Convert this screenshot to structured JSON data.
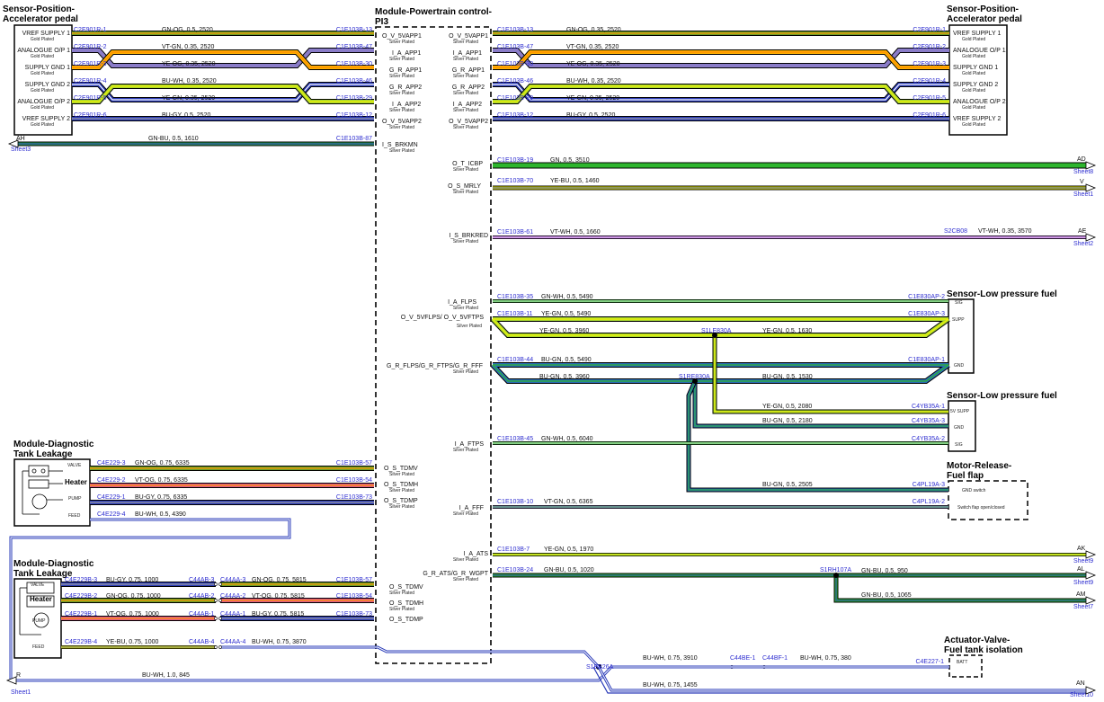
{
  "components": {
    "app_left": {
      "title1": "Sensor-Position-",
      "title2": "Accelerator pedal",
      "pins": [
        {
          "name": "VREF SUPPLY 1",
          "note": "Gold Plated"
        },
        {
          "name": "ANALOGUE O/P 1",
          "note": "Gold Plated"
        },
        {
          "name": "SUPPLY GND 1",
          "note": "Gold Plated"
        },
        {
          "name": "SUPPLY GND 2",
          "note": "Gold Plated"
        },
        {
          "name": "ANALOGUE O/P 2",
          "note": "Gold Plated"
        },
        {
          "name": "VREF SUPPLY 2",
          "note": "Gold Plated"
        }
      ]
    },
    "app_right": {
      "title1": "Sensor-Position-",
      "title2": "Accelerator pedal",
      "pins": [
        {
          "name": "VREF SUPPLY 1",
          "note": "Gold Plated"
        },
        {
          "name": "ANALOGUE O/P 1",
          "note": "Gold Plated"
        },
        {
          "name": "SUPPLY GND 1",
          "note": "Gold Plated"
        },
        {
          "name": "SUPPLY GND 2",
          "note": "Gold Plated"
        },
        {
          "name": "ANALOGUE O/P 2",
          "note": "Gold Plated"
        },
        {
          "name": "VREF SUPPLY 2",
          "note": "Gold Plated"
        }
      ]
    },
    "pcm": {
      "title1": "Module-Powertrain control-",
      "title2": "PI3"
    },
    "pcm_left_pins": [
      {
        "name": "O_V_5VAPP1",
        "note": "Silver Plated"
      },
      {
        "name": "I_A_APP1",
        "note": "Silver Plated"
      },
      {
        "name": "G_R_APP1",
        "note": "Silver Plated"
      },
      {
        "name": "G_R_APP2",
        "note": "Silver Plated"
      },
      {
        "name": "I_A_APP2",
        "note": "Silver Plated"
      },
      {
        "name": "O_V_5VAPP2",
        "note": "Silver Plated"
      },
      {
        "name": "I_S_BRKMN",
        "note": "Silver Plated"
      },
      {
        "name": "O_S_TDMV",
        "note": "Silver Plated"
      },
      {
        "name": "O_S_TDMH",
        "note": "Silver Plated"
      },
      {
        "name": "O_S_TDMP",
        "note": "Silver Plated"
      },
      {
        "name": "O_S_TDMV",
        "note": "Silver Plated"
      },
      {
        "name": "O_S_TDMH",
        "note": "Silver Plated"
      },
      {
        "name": "O_S_TDMP",
        "note": ""
      }
    ],
    "pcm_right_pins": [
      {
        "name": "O_V_5VAPP1",
        "note": "Silver Plated"
      },
      {
        "name": "I_A_APP1",
        "note": "Silver Plated"
      },
      {
        "name": "G_R_APP1",
        "note": "Silver Plated"
      },
      {
        "name": "G_R_APP2",
        "note": "Silver Plated"
      },
      {
        "name": "I_A_APP2",
        "note": "Silver Plated"
      },
      {
        "name": "O_V_5VAPP2",
        "note": "Silver Plated"
      },
      {
        "name": "O_T_ICBP",
        "note": "Silver Plated"
      },
      {
        "name": "O_S_MRLY",
        "note": "Silver Plated"
      },
      {
        "name": "I_S_BRKRED",
        "note": "Silver Plated"
      },
      {
        "name": "I_A_FLPS",
        "note": "Silver Plated"
      },
      {
        "name": "O_V_5VFLPS/ O_V_5VFTPS",
        "note": "Silver Plated"
      },
      {
        "name": "G_R_FLPS/G_R_FTPS/G_R_FFF",
        "note": "Silver Plated"
      },
      {
        "name": "I_A_FTPS",
        "note": "Silver Plated"
      },
      {
        "name": "I_A_FFF",
        "note": "Silver Plated"
      },
      {
        "name": "I_A_ATS",
        "note": "Silver Plated"
      },
      {
        "name": "G_R_ATS/G_R_WGPT",
        "note": "Silver Plated"
      }
    ],
    "lpf1": {
      "title": "Sensor-Low pressure fuel",
      "pins": [
        "SIG",
        "SUPP",
        "GND"
      ]
    },
    "lpf2": {
      "title": "Sensor-Low pressure fuel",
      "pins": [
        "5V SUPP",
        "GND",
        "SIG"
      ]
    },
    "motor": {
      "title1": "Motor-Release-",
      "title2": "Fuel flap",
      "line1": "GND switch",
      "line2": "Switch flap open/closed"
    },
    "dtl1": {
      "title1": "Module-Diagnostic",
      "title2": "Tank Leakage",
      "pins": [
        "VALVE",
        "Heater",
        "PUMP",
        "FEED"
      ]
    },
    "dtl2": {
      "title1": "Module-Diagnostic",
      "title2": "Tank Leakage",
      "pins": [
        "VALVE",
        "Heater",
        "PUMP",
        "FEED"
      ]
    },
    "valve": {
      "title1": "Actuator-Valve-",
      "title2": "Fuel tank isolation",
      "pin": "BATT"
    }
  },
  "wires_left_app": [
    {
      "from": "C2E901R-1",
      "spec": "GN-OG, 0.5, 2520",
      "to": "C1E103B-13"
    },
    {
      "from": "C2E901R-2",
      "spec": "VT-GN, 0.35, 2520",
      "to": "C1E103B-47"
    },
    {
      "from": "C2E901R-3",
      "spec": "YE-OG, 0.35, 2520",
      "to": "C1E103B-30"
    },
    {
      "from": "C2E901R-4",
      "spec": "BU-WH, 0.35, 2520",
      "to": "C1E103B-46"
    },
    {
      "from": "C2E901R-5",
      "spec": "YE-GN, 0.35, 2520",
      "to": "C1E103B-29"
    },
    {
      "from": "C2E901R-6",
      "spec": "BU-GY, 0.5, 2520",
      "to": "C1E103B-12"
    }
  ],
  "wire_brkmn": {
    "label": "AH",
    "sheet": "Sheet3",
    "spec": "GN-BU, 0.5, 1610",
    "to": "C1E103B-87"
  },
  "wires_right_app": [
    {
      "from": "C1E103B-13",
      "spec": "GN-OG, 0.35, 2520",
      "to": "C2E901R-1"
    },
    {
      "from": "C1E103B-47",
      "spec": "VT-GN, 0.35, 2520",
      "to": "C2E901R-2"
    },
    {
      "from": "C1E103B-30",
      "spec": "YE-OG, 0.35, 2520",
      "to": "C2E901R-3"
    },
    {
      "from": "C1E103B-46",
      "spec": "BU-WH, 0.35, 2520",
      "to": "C2E901R-4"
    },
    {
      "from": "C1E103B-29",
      "spec": "YE-GN, 0.35, 2520",
      "to": "C2E901R-5"
    },
    {
      "from": "C1E103B-12",
      "spec": "BU-GY, 0.5, 2520",
      "to": "C2E901R-6"
    }
  ],
  "wires_right_misc": {
    "icbp": {
      "from": "C1E103B-19",
      "spec": "GN, 0.5, 3510",
      "label": "AD",
      "sheet": "Sheet8"
    },
    "mrly": {
      "from": "C1E103B-70",
      "spec": "YE-BU, 0.5, 1460",
      "label": "V",
      "sheet": "Sheet1"
    },
    "brkred": {
      "from": "C1E103B-61",
      "spec": "VT-WH, 0.5, 1660",
      "splice": "S2CB08",
      "spec2": "VT-WH, 0.35, 3570",
      "label": "AE",
      "sheet": "Sheet2"
    }
  },
  "wires_fuel": {
    "flps_sig": {
      "from": "C1E103B-35",
      "spec": "GN-WH, 0.5, 5490",
      "to": "C1E830AP-2"
    },
    "supp": {
      "from": "C1E103B-11",
      "spec": "YE-GN, 0.5, 5490",
      "to": "C1E830AP-3"
    },
    "supp_a": "YE-GN, 0.5, 3960",
    "supp_splice": "S1LE830A",
    "supp_b": "YE-GN, 0.5, 1630",
    "gnd": {
      "from": "C1E103B-44",
      "spec": "BU-GN, 0.5, 5490",
      "to": "C1E830AP-1"
    },
    "gnd_a": "BU-GN, 0.5, 3960",
    "gnd_splice": "S1RE830A",
    "gnd_b": "BU-GN, 0.5, 1530",
    "ftps_supp": {
      "spec": "YE-GN, 0.5, 2080",
      "to": "C4YB35A-1"
    },
    "ftps_gnd": {
      "spec": "BU-GN, 0.5, 2180",
      "to": "C4YB35A-3"
    },
    "ftps_sig": {
      "from": "C1E103B-45",
      "spec": "GN-WH, 0.5, 6040",
      "to": "C4YB35A-2"
    },
    "flap_gnd": {
      "spec": "BU-GN, 0.5, 2505",
      "to": "C4PL19A-3"
    },
    "fff": {
      "from": "C1E103B-10",
      "spec": "VT-GN, 0.5, 6365",
      "to": "C4PL19A-2"
    },
    "ats": {
      "from": "C1E103B-7",
      "spec": "YE-GN, 0.5, 1970",
      "label": "AK",
      "sheet": "Sheet9"
    },
    "wgpt": {
      "from": "C1E103B-24",
      "spec": "GN-BU, 0.5, 1020",
      "splice": "S1RH107A",
      "spec2": "GN-BU, 0.5, 950",
      "label": "AL",
      "sheet": "Sheet9",
      "spec3": "GN-BU, 0.5, 1065",
      "label2": "AM",
      "sheet2": "Sheet7"
    }
  },
  "wires_dtl1": [
    {
      "from": "C4E229-3",
      "spec": "GN-OG, 0.75, 6335",
      "to": "C1E103B-57"
    },
    {
      "from": "C4E229-2",
      "spec": "VT-OG, 0.75, 6335",
      "to": "C1E103B-54"
    },
    {
      "from": "C4E229-1",
      "spec": "BU-GY, 0.75, 6335",
      "to": "C1E103B-73"
    },
    {
      "from": "C4E229-4",
      "spec": "BU-WH, 0.5, 4390"
    }
  ],
  "wires_dtl2": [
    {
      "from": "C4E229B-3",
      "spec": "BU-GY, 0.75, 1000",
      "mid1": "C44AB-3",
      "mid2": "C44AA-3",
      "spec2": "GN-OG, 0.75, 5815",
      "to": "C1E103B-57"
    },
    {
      "from": "C4E229B-2",
      "spec": "GN-OG, 0.75, 1000",
      "mid1": "C44AB-2",
      "mid2": "C44AA-2",
      "spec2": "VT-OG, 0.75, 5815",
      "to": "C1E103B-54"
    },
    {
      "from": "C4E229B-1",
      "spec": "VT-OG, 0.75, 1000",
      "mid1": "C44AB-1",
      "mid2": "C44AA-1",
      "spec2": "BU-GY, 0.75, 5815",
      "to": "C1E103B-73"
    },
    {
      "from": "C4E229B-4",
      "spec": "YE-BU, 0.75, 1000",
      "mid1": "C44AB-4",
      "mid2": "C44AA-4",
      "spec2": "BU-WH, 0.75, 3870"
    }
  ],
  "wires_feed": {
    "splice": "S1BB26A",
    "r": {
      "label": "R",
      "sheet": "Sheet1",
      "spec": "BU-WH, 1.0, 845"
    },
    "batt1": "BU-WH, 0.75, 3910",
    "mid1": "C44BE-1",
    "mid2": "C44BF-1",
    "batt2": "BU-WH, 0.75, 380",
    "to": "C4E227-1",
    "an": {
      "spec": "BU-WH, 0.75, 1455",
      "label": "AN",
      "sheet": "Sheet10"
    }
  }
}
